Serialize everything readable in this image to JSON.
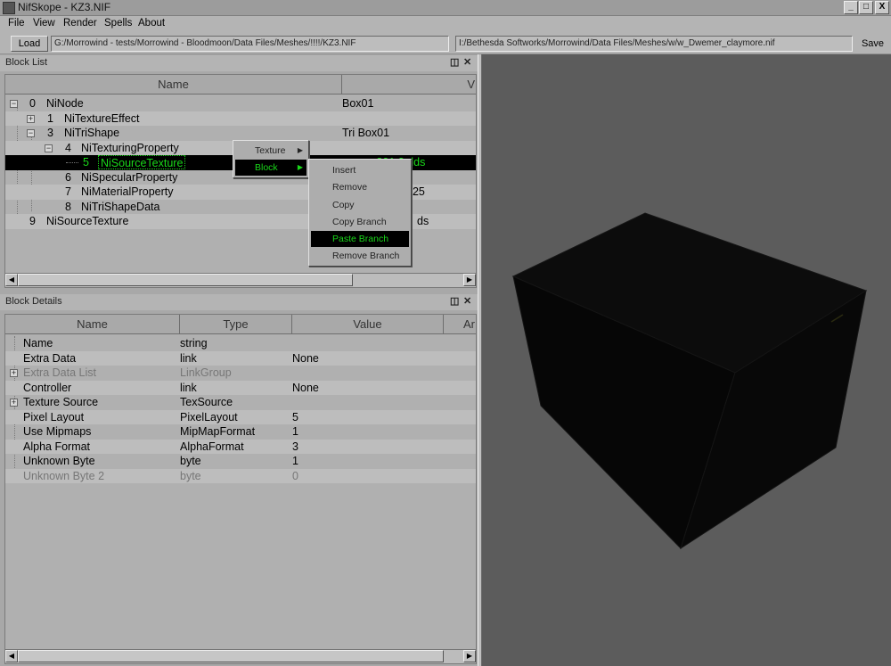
{
  "window": {
    "title": "NifSkope - KZ3.NIF",
    "min_btn": "_",
    "max_btn": "□",
    "close_btn": "X"
  },
  "menu": {
    "file": "File",
    "view": "View",
    "render": "Render",
    "spells": "Spells",
    "about": "About"
  },
  "toolbar": {
    "load_label": "Load",
    "load_path": "G:/Morrowind - tests/Morrowind - Bloodmoon/Data Files/Meshes/!!!!/KZ3.NIF",
    "save_path": "I:/Bethesda Softworks/Morrowind/Data Files/Meshes/w/w_Dwemer_claymore.nif",
    "save_label": "Save"
  },
  "block_list": {
    "title": "Block List",
    "columns": [
      "Name",
      "V"
    ],
    "rows": [
      {
        "num": "0",
        "name": "NiNode",
        "value": "Box01"
      },
      {
        "num": "1",
        "name": "NiTextureEffect",
        "value": ""
      },
      {
        "num": "3",
        "name": "NiTriShape",
        "value": "Tri Box01"
      },
      {
        "num": "4",
        "name": "NiTexturingProperty",
        "value": ""
      },
      {
        "num": "5",
        "name": "NiSourceTexture",
        "value": "...801 2.dds"
      },
      {
        "num": "6",
        "name": "NiSpecularProperty",
        "value": ""
      },
      {
        "num": "7",
        "name": "NiMaterialProperty",
        "value": "#25"
      },
      {
        "num": "8",
        "name": "NiTriShapeData",
        "value": ""
      },
      {
        "num": "9",
        "name": "NiSourceTexture",
        "value": "ds"
      }
    ]
  },
  "context_menu": {
    "items": [
      "Texture",
      "Block"
    ],
    "submenu": [
      "Insert",
      "Remove",
      "Copy",
      "Copy Branch",
      "Paste Branch",
      "Remove Branch"
    ]
  },
  "block_details": {
    "title": "Block Details",
    "columns": [
      "Name",
      "Type",
      "Value",
      "Ar"
    ],
    "rows": [
      {
        "name": "Name",
        "type": "string",
        "value": ""
      },
      {
        "name": "Extra Data",
        "type": "link",
        "value": "None"
      },
      {
        "name": "Extra Data List",
        "type": "LinkGroup",
        "value": ""
      },
      {
        "name": "Controller",
        "type": "link",
        "value": "None"
      },
      {
        "name": "Texture Source",
        "type": "TexSource",
        "value": ""
      },
      {
        "name": "Pixel Layout",
        "type": "PixelLayout",
        "value": "5"
      },
      {
        "name": "Use Mipmaps",
        "type": "MipMapFormat",
        "value": "1"
      },
      {
        "name": "Alpha Format",
        "type": "AlphaFormat",
        "value": "3"
      },
      {
        "name": "Unknown Byte",
        "type": "byte",
        "value": "1"
      },
      {
        "name": "Unknown Byte 2",
        "type": "byte",
        "value": "0"
      }
    ]
  },
  "colors": {
    "selection_bg": "#000000",
    "selection_text": "#19d719",
    "viewport_bg": "#5c5c5c",
    "cube": "#0a0a0a"
  },
  "icons": {
    "dock_float": "float-icon",
    "dock_close": "close-icon",
    "expand": "plus-icon",
    "collapse": "minus-icon",
    "submenu": "triangle-right-icon"
  }
}
